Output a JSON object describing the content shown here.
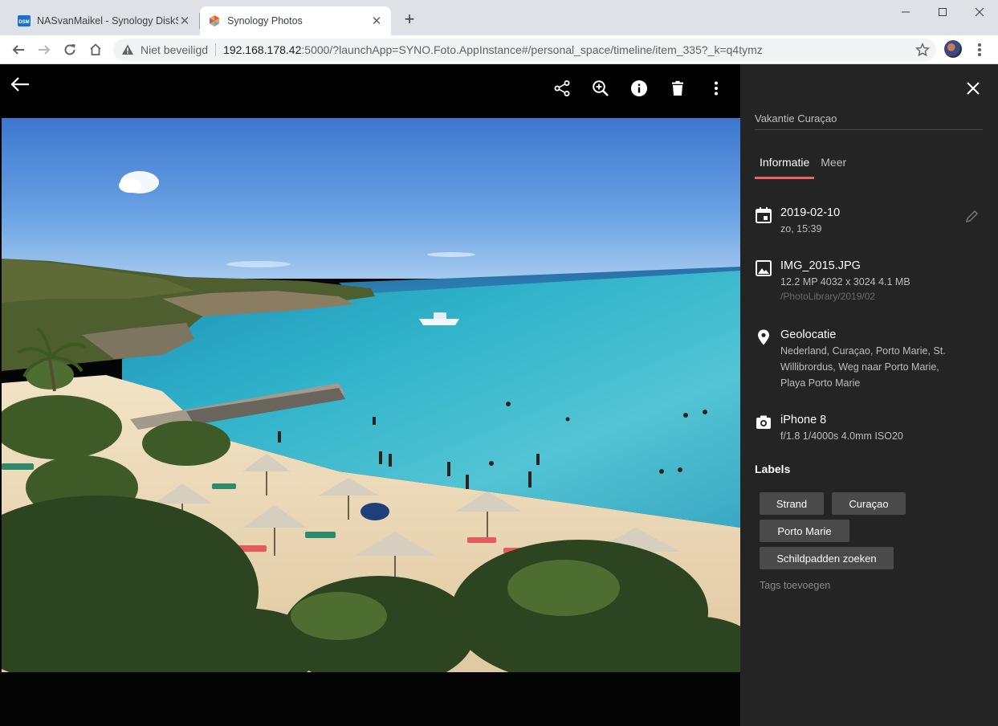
{
  "browser": {
    "tabs": [
      {
        "title": "NASvanMaikel - Synology DiskSta",
        "favicon": "dsm-icon",
        "favicon_text": "DSM",
        "active": false
      },
      {
        "title": "Synology Photos",
        "favicon": "synology-photos-icon",
        "active": true
      }
    ],
    "address": {
      "security_label": "Niet beveiligd",
      "host": "192.168.178.42",
      "rest": ":5000/?launchApp=SYNO.Foto.AppInstance#/personal_space/timeline/item_335?_k=q4tymz"
    }
  },
  "viewer": {
    "toolbar_icons": [
      "back-arrow-icon",
      "share-icon",
      "zoom-in-icon",
      "info-icon",
      "delete-icon",
      "more-vert-icon"
    ]
  },
  "panel": {
    "album": "Vakantie Curaçao",
    "tabs": [
      {
        "label": "Informatie",
        "active": true
      },
      {
        "label": "Meer",
        "active": false
      }
    ],
    "date": {
      "main": "2019-02-10",
      "sub": "zo, 15:39"
    },
    "file": {
      "main": "IMG_2015.JPG",
      "sub": "12.2 MP  4032 x 3024  4.1 MB",
      "path": "/PhotoLibrary/2019/02"
    },
    "location": {
      "main": "Geolocatie",
      "sub": "Nederland, Curaçao, Porto Marie, St. Willibrordus, Weg naar Porto Marie, Playa Porto Marie"
    },
    "camera": {
      "main": "iPhone 8",
      "sub": "f/1.8  1/4000s  4.0mm  ISO20"
    },
    "labels_heading": "Labels",
    "labels": [
      "Strand",
      "Curaçao",
      "Porto Marie",
      "Schildpadden zoeken"
    ],
    "add_tags": "Tags toevoegen"
  },
  "colors": {
    "accent": "#e8665a",
    "panel_bg": "#242424",
    "chip_bg": "#4a4a4a"
  }
}
